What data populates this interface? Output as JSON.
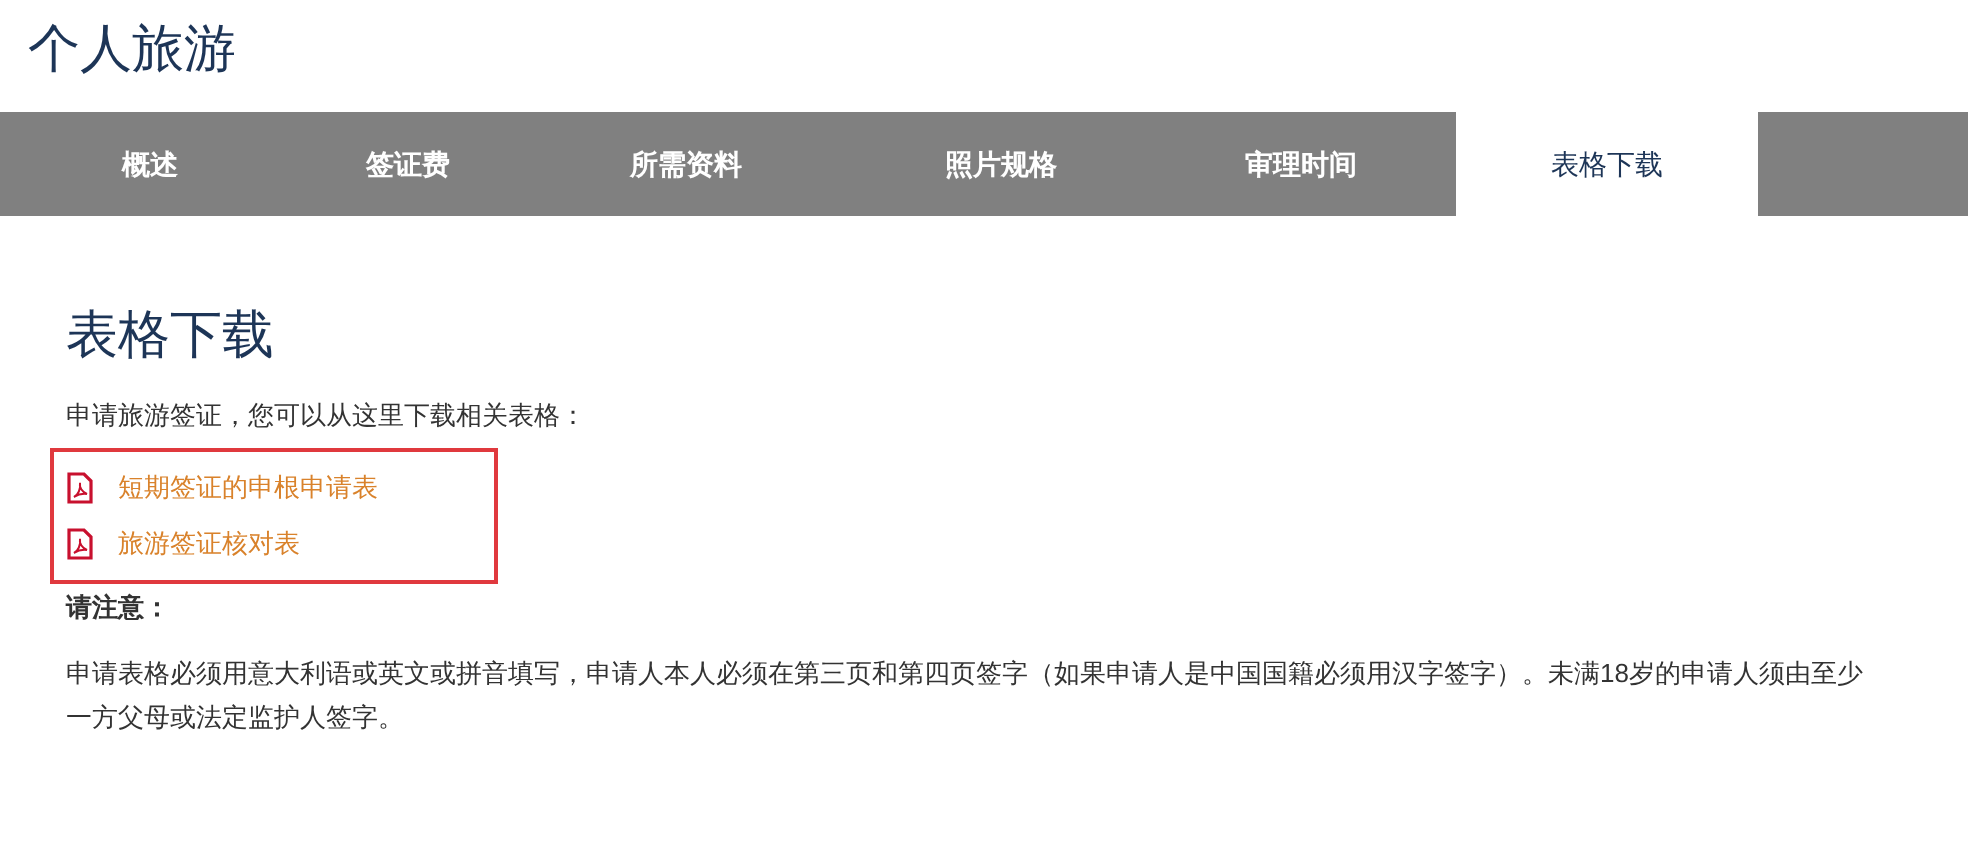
{
  "page_title": "个人旅游",
  "tabs": [
    {
      "label": "概述",
      "selected": false
    },
    {
      "label": "签证费",
      "selected": false
    },
    {
      "label": "所需资料",
      "selected": false
    },
    {
      "label": "照片规格",
      "selected": false
    },
    {
      "label": "审理时间",
      "selected": false
    },
    {
      "label": "表格下载",
      "selected": true
    }
  ],
  "section_title": "表格下载",
  "intro": "申请旅游签证，您可以从这里下载相关表格：",
  "downloads": {
    "highlighted": true,
    "items": [
      {
        "label": "短期签证的申根申请表"
      },
      {
        "label": "旅游签证核对表"
      }
    ]
  },
  "note_heading": "请注意：",
  "note_text": "申请表格必须用意大利语或英文或拼音填写，申请人本人必须在第三页和第四页签字（如果申请人是中国国籍必须用汉字签字）。未满18岁的申请人须由至少一方父母或法定监护人签字。"
}
